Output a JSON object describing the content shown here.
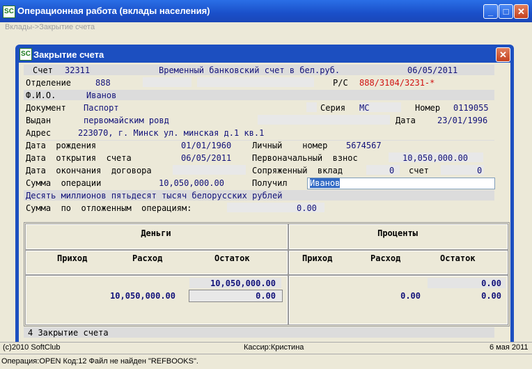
{
  "app": {
    "title": "Операционная работа (вклады населения)",
    "icon_text": "SC",
    "breadcrumb": "Вклады->Закрытие счета"
  },
  "dialog": {
    "title": "Закрытие счета"
  },
  "form": {
    "account_label": "Счет",
    "account_value": "32311",
    "account_type": "Временный банковский счет в бел.руб.",
    "account_date": "06/05/2011",
    "branch_label": "Отделение",
    "branch_value": "888",
    "rs_label": "Р/С",
    "rs_value": "888/3104/3231-*",
    "fio_label": "Ф.И.О.",
    "fio_value": "Иванов",
    "doc_label": "Документ",
    "doc_value": "Паспорт",
    "series_label": "Серия",
    "series_value": "МС",
    "number_label": "Номер",
    "number_value": "0119055",
    "issued_label": "Выдан",
    "issued_value": "первомайским ровд",
    "date_label": "Дата",
    "date_value": "23/01/1996",
    "address_label": "Адрес",
    "address_value": "223070, г. Минск ул. минская д.1 кв.1",
    "birth_label": "Дата  рождения",
    "birth_value": "01/01/1960",
    "personal_label": "Личный    номер",
    "personal_value": "5674567",
    "open_label": "Дата  открытия  счета",
    "open_value": "06/05/2011",
    "initial_label": "Первоначальный  взнос",
    "initial_value": "10,050,000.00",
    "end_label": "Дата  окончания  договора",
    "linked_label": "Сопряженный  вклад",
    "linked_value": "0",
    "linked_account_label": "счет",
    "linked_account_value": "0",
    "sum_label": "Сумма  операции",
    "sum_value": "10,050,000.00",
    "received_label": "Получил",
    "received_value": "Иванов",
    "sum_words": "Десять миллионов пятьдесят тысяч белорусских рублей",
    "deferred_label": "Сумма  по  отложенным  операциям:",
    "deferred_value": "0.00",
    "footer_code": "4 Закрытие счета"
  },
  "grid": {
    "money_header": "Деньги",
    "interest_header": "Проценты",
    "col_income": "Приход",
    "col_expense": "Расход",
    "col_balance": "Остаток",
    "money_balance_1": "10,050,000.00",
    "money_expense_2": "10,050,000.00",
    "money_balance_2": "0.00",
    "interest_balance_1": "0.00",
    "interest_expense_2": "0.00",
    "interest_balance_2": "0.00"
  },
  "status": {
    "copyright": "(c)2010 SoftClub",
    "cashier": "Кассир:Кристина",
    "date": "6 мая 2011",
    "message": "Операция:OPEN Код:12 Файл не найден \"REFBOOKS\"."
  }
}
